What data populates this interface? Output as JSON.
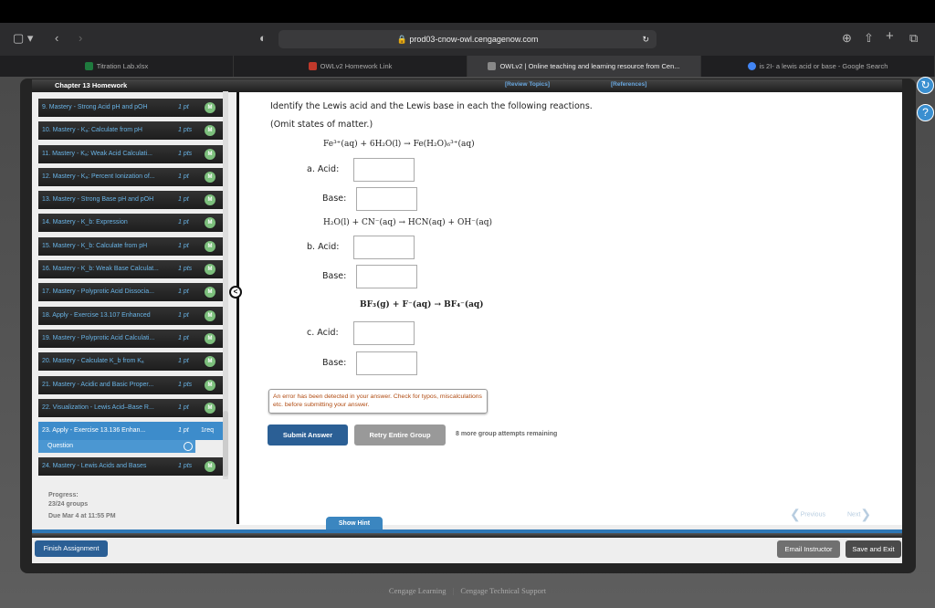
{
  "browser": {
    "url": "prod03-cnow-owl.cengagenow.com",
    "tabs": [
      {
        "label": "Titration Lab.xlsx",
        "color": "#1f7a3e"
      },
      {
        "label": "OWLv2 Homework Link",
        "color": "#c0392b"
      },
      {
        "label": "OWLv2 | Online teaching and learning resource from Cen...",
        "color": "#888888"
      },
      {
        "label": "is 2I- a lewis acid or base - Google Search",
        "color": "#4285f4"
      }
    ]
  },
  "header": {
    "title": "Chapter 13 Homework",
    "review": "[Review Topics]",
    "references": "[References]"
  },
  "sidebar": {
    "items": [
      {
        "label": "9. Mastery - Strong Acid pH and pOH",
        "pts": "1 pt",
        "badge": "M"
      },
      {
        "label": "10. Mastery - Kₐ: Calculate from pH",
        "pts": "1 pts",
        "badge": "M"
      },
      {
        "label": "11. Mastery - Kₐ: Weak Acid Calculati...",
        "pts": "1 pts",
        "badge": "M"
      },
      {
        "label": "12. Mastery - Kₐ: Percent Ionization of...",
        "pts": "1 pt",
        "badge": "M"
      },
      {
        "label": "13. Mastery - Strong Base pH and pOH",
        "pts": "1 pt",
        "badge": "M"
      },
      {
        "label": "14. Mastery - K_b: Expression",
        "pts": "1 pt",
        "badge": "M"
      },
      {
        "label": "15. Mastery - K_b: Calculate from pH",
        "pts": "1 pt",
        "badge": "M"
      },
      {
        "label": "16. Mastery - K_b: Weak Base Calculat...",
        "pts": "1 pts",
        "badge": "M"
      },
      {
        "label": "17. Mastery - Polyprotic Acid Dissocia...",
        "pts": "1 pt",
        "badge": "M"
      },
      {
        "label": "18. Apply - Exercise 13.107 Enhanced",
        "pts": "1 pt",
        "badge": "M"
      },
      {
        "label": "19. Mastery - Polyprotic Acid Calculati...",
        "pts": "1 pt",
        "badge": "M"
      },
      {
        "label": "20. Mastery - Calculate K_b from Kₐ",
        "pts": "1 pt",
        "badge": "M"
      },
      {
        "label": "21. Mastery - Acidic and Basic Proper...",
        "pts": "1 pts",
        "badge": "M"
      },
      {
        "label": "22. Visualization - Lewis Acid–Base R...",
        "pts": "1 pt",
        "badge": "M"
      },
      {
        "label": "23. Apply - Exercise 13.136 Enhan...",
        "pts": "1 pt",
        "req": "1req",
        "sub": "Question"
      },
      {
        "label": "24. Mastery - Lewis Acids and Bases",
        "pts": "1 pts",
        "badge": "M"
      }
    ],
    "progress_label": "Progress:",
    "progress": "23/24 groups",
    "due": "Due Mar 4 at 11:55 PM"
  },
  "question": {
    "prompt": "Identify the Lewis acid and the Lewis base in each the following reactions.",
    "note": "(Omit states of matter.)",
    "parts": [
      {
        "eq": "Fe³⁺(aq) + 6H₂O(l) → Fe(H₂O)₆³⁺(aq)",
        "acid_label": "a.  Acid:",
        "base_label": "Base:",
        "acid": "",
        "base": ""
      },
      {
        "eq": "H₂O(l) + CN⁻(aq) → HCN(aq) + OH⁻(aq)",
        "acid_label": "b.  Acid:",
        "base_label": "Base:",
        "acid": "",
        "base": ""
      },
      {
        "eq": "BF₃(g) + F⁻(aq) → BF₄⁻(aq)",
        "acid_label": "c.  Acid:",
        "base_label": "Base:",
        "acid": "",
        "base": ""
      }
    ],
    "error": "An error has been detected in your answer. Check for typos, miscalculations etc. before submitting your answer."
  },
  "actions": {
    "submit": "Submit Answer",
    "retry": "Retry Entire Group",
    "remaining": "8 more group attempts remaining",
    "hint": "Show Hint",
    "previous": "Previous",
    "next": "Next",
    "finish": "Finish Assignment",
    "email": "Email Instructor",
    "save": "Save and Exit"
  },
  "footer": {
    "left": "Cengage Learning",
    "sep": "|",
    "right": "Cengage Technical Support"
  }
}
